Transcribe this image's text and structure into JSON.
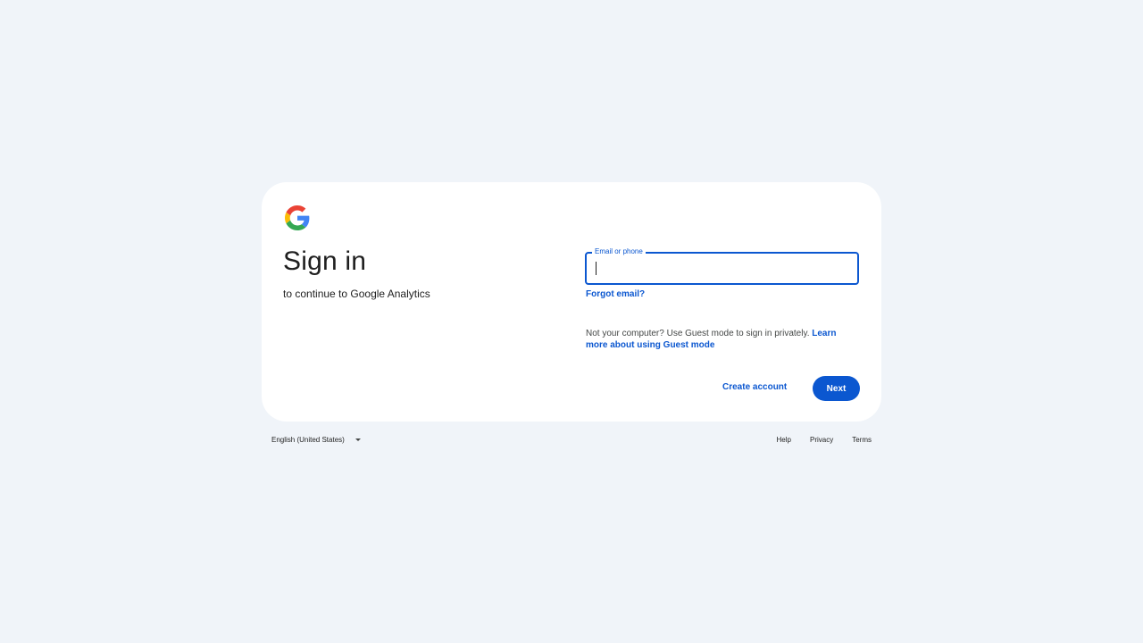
{
  "colors": {
    "background": "#f0f4f9",
    "card": "#ffffff",
    "accent": "#0b57d0",
    "google_blue": "#4285F4",
    "google_red": "#EA4335",
    "google_yellow": "#FBBC05",
    "google_green": "#34A853"
  },
  "logo": {
    "icon": "google-g-icon"
  },
  "signin": {
    "title": "Sign in",
    "subtitle": "to continue to Google Analytics",
    "email_label": "Email or phone",
    "email_value": "",
    "forgot_email": "Forgot email?",
    "guest_text": "Not your computer? Use Guest mode to sign in privately.",
    "guest_link": "Learn more about using Guest mode",
    "create_account": "Create account",
    "next": "Next"
  },
  "footer": {
    "language": "English (United States)",
    "language_icon": "dropdown-caret-icon",
    "links": {
      "help": "Help",
      "privacy": "Privacy",
      "terms": "Terms"
    }
  }
}
